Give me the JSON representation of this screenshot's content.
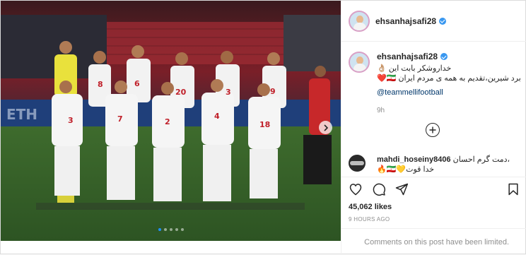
{
  "post": {
    "username": "ehsanhajsafi28",
    "caption_line1": "خداروشکر بابت این 👌🏼",
    "caption_line2": "برد شیرین،تقدیم به همه ی مردم ایران 🇮🇷❤️",
    "mention": "@teammellifootball",
    "caption_time": "9h",
    "likes": "45,062 likes",
    "posted_ago": "9 HOURS AGO",
    "comments_limited": "Comments on this post have been limited."
  },
  "comment": {
    "username": "mahdi_hoseiny8406",
    "text_line1": "دمت گرم احسان،",
    "text_line2": "خدا قوت💛🇮🇷🔥"
  },
  "carousel": {
    "total": 5,
    "active": 0
  },
  "icons": {
    "next": "chevron-right-icon",
    "load_more": "plus-circle-icon",
    "like": "heart-icon",
    "comment": "comment-icon",
    "share": "share-icon",
    "save": "bookmark-icon"
  },
  "colors": {
    "verified": "#3897f0",
    "link": "#00376b",
    "muted": "#8e8e8e"
  }
}
